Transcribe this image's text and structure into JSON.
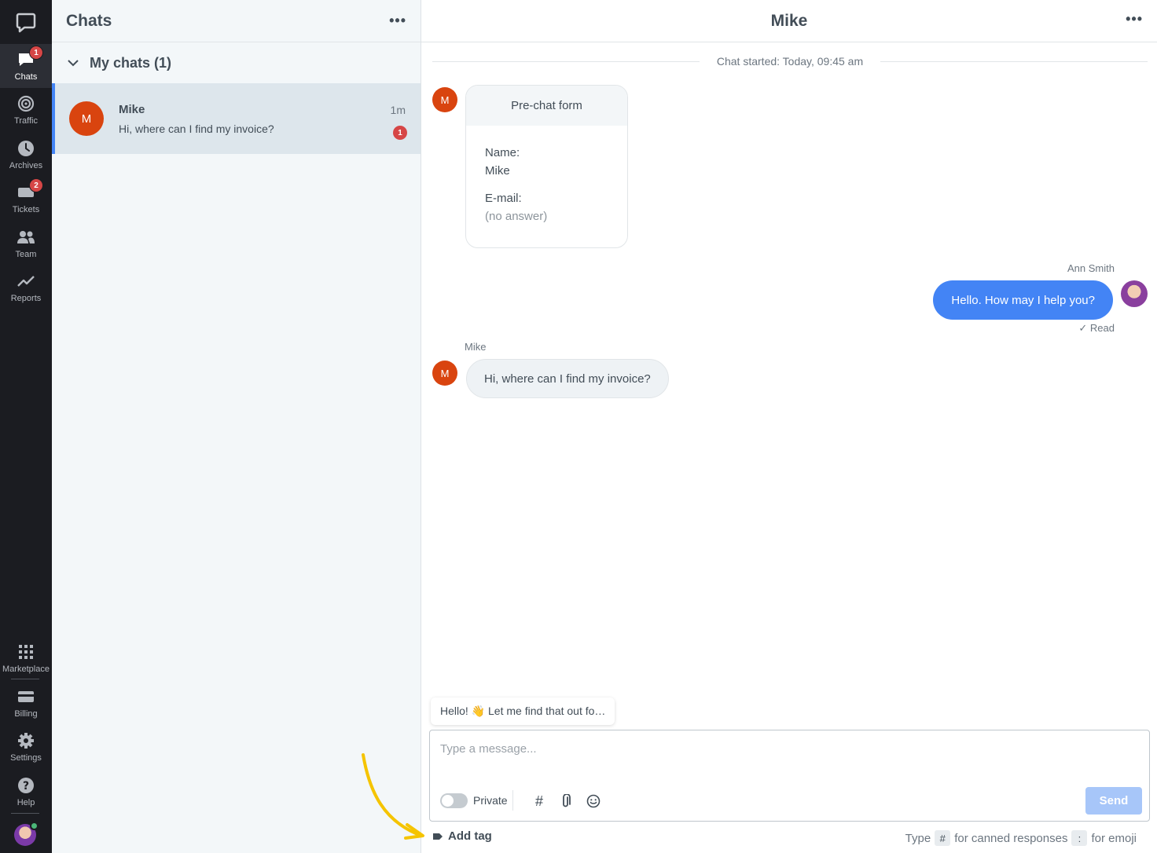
{
  "rail": {
    "items": [
      {
        "label": "Chats",
        "badge": "1"
      },
      {
        "label": "Traffic"
      },
      {
        "label": "Archives"
      },
      {
        "label": "Tickets",
        "badge": "2"
      },
      {
        "label": "Team"
      },
      {
        "label": "Reports"
      },
      {
        "label": "Marketplace"
      },
      {
        "label": "Billing"
      },
      {
        "label": "Settings"
      },
      {
        "label": "Help"
      }
    ]
  },
  "chat_list": {
    "title": "Chats",
    "group_label": "My chats (1)",
    "items": [
      {
        "initial": "M",
        "name": "Mike",
        "preview": "Hi, where can I find my invoice?",
        "time": "1m",
        "unread": "1"
      }
    ]
  },
  "conversation": {
    "title": "Mike",
    "started": "Chat started: Today, 09:45 am",
    "form": {
      "title": "Pre-chat form",
      "name_label": "Name:",
      "name_value": "Mike",
      "email_label": "E-mail:",
      "email_value": "(no answer)"
    },
    "visitor_initial": "M",
    "agent_name": "Ann Smith",
    "agent_message": "Hello. How may I help you?",
    "read_status": "✓ Read",
    "visitor_name": "Mike",
    "visitor_message": "Hi, where can I find my invoice?"
  },
  "composer": {
    "suggestion": "Hello! 👋 Let me find that out fo…",
    "placeholder": "Type a message...",
    "private_label": "Private",
    "send_label": "Send",
    "add_tag_label": "Add tag",
    "hint_type": "Type",
    "hint_hash_key": "#",
    "hint_canned": "for canned responses",
    "hint_colon_key": ":",
    "hint_emoji": "for emoji"
  },
  "colors": {
    "accent": "#4384f5",
    "rail_bg": "#1b1c21",
    "badge": "#d64646",
    "visitor_avatar": "#d9440f",
    "annotation_arrow": "#f5c400"
  }
}
